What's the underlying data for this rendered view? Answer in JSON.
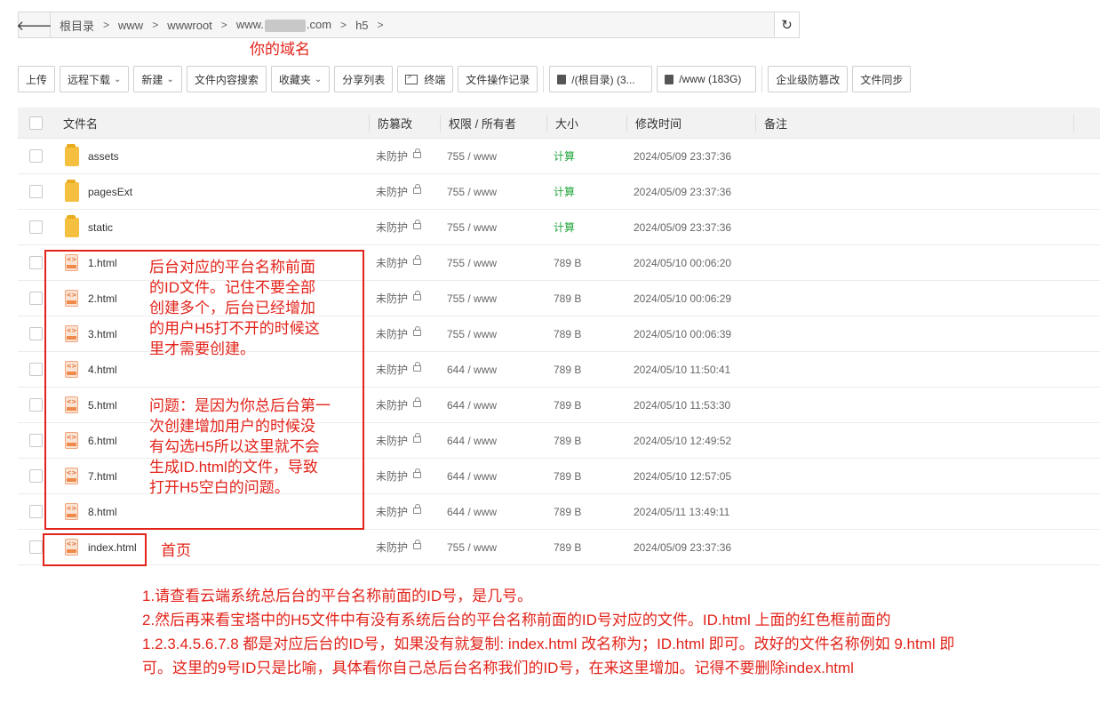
{
  "pathbar": {
    "back_icon": "arrow-left-icon",
    "crumbs": [
      "根目录",
      "www",
      "wwwroot",
      "www.",
      ".com",
      "h5"
    ],
    "refresh_icon": "refresh-icon"
  },
  "domain_note": "你的域名",
  "toolbar": {
    "upload": "上传",
    "remote_download": "远程下载",
    "new": "新建",
    "content_search": "文件内容搜索",
    "favorites": "收藏夹",
    "share_list": "分享列表",
    "terminal": "终端",
    "file_log": "文件操作记录",
    "disk_root": "/(根目录) (3...",
    "disk_www": "/www (183G)",
    "tamper_protect": "企业级防篡改",
    "file_sync": "文件同步"
  },
  "table": {
    "headers": {
      "name": "文件名",
      "tamper": "防篡改",
      "perm": "权限 / 所有者",
      "size": "大小",
      "mtime": "修改时间",
      "remark": "备注"
    },
    "rows": [
      {
        "type": "folder",
        "name": "assets",
        "tamper": "未防护",
        "perm": "755 / www",
        "size": "计算",
        "mtime": "2024/05/09 23:37:36"
      },
      {
        "type": "folder",
        "name": "pagesExt",
        "tamper": "未防护",
        "perm": "755 / www",
        "size": "计算",
        "mtime": "2024/05/09 23:37:36"
      },
      {
        "type": "folder",
        "name": "static",
        "tamper": "未防护",
        "perm": "755 / www",
        "size": "计算",
        "mtime": "2024/05/09 23:37:36"
      },
      {
        "type": "html",
        "name": "1.html",
        "tamper": "未防护",
        "perm": "755 / www",
        "size": "789 B",
        "mtime": "2024/05/10 00:06:20"
      },
      {
        "type": "html",
        "name": "2.html",
        "tamper": "未防护",
        "perm": "755 / www",
        "size": "789 B",
        "mtime": "2024/05/10 00:06:29"
      },
      {
        "type": "html",
        "name": "3.html",
        "tamper": "未防护",
        "perm": "755 / www",
        "size": "789 B",
        "mtime": "2024/05/10 00:06:39"
      },
      {
        "type": "html",
        "name": "4.html",
        "tamper": "未防护",
        "perm": "644 / www",
        "size": "789 B",
        "mtime": "2024/05/10 11:50:41"
      },
      {
        "type": "html",
        "name": "5.html",
        "tamper": "未防护",
        "perm": "644 / www",
        "size": "789 B",
        "mtime": "2024/05/10 11:53:30"
      },
      {
        "type": "html",
        "name": "6.html",
        "tamper": "未防护",
        "perm": "644 / www",
        "size": "789 B",
        "mtime": "2024/05/10 12:49:52"
      },
      {
        "type": "html",
        "name": "7.html",
        "tamper": "未防护",
        "perm": "644 / www",
        "size": "789 B",
        "mtime": "2024/05/10 12:57:05"
      },
      {
        "type": "html",
        "name": "8.html",
        "tamper": "未防护",
        "perm": "644 / www",
        "size": "789 B",
        "mtime": "2024/05/11 13:49:11"
      },
      {
        "type": "html",
        "name": "index.html",
        "tamper": "未防护",
        "perm": "755 / www",
        "size": "789 B",
        "mtime": "2024/05/09 23:37:36"
      }
    ]
  },
  "annotations": {
    "id_files_note": [
      "后台对应的平台名称前面",
      "的ID文件。记住不要全部",
      "创建多个，后台已经增加",
      "的用户H5打不开的时候这",
      "里才需要创建。"
    ],
    "problem_note": [
      "问题：是因为你总后台第一",
      "次创建增加用户的时候没",
      "有勾选H5所以这里就不会",
      "生成ID.html的文件，导致",
      "打开H5空白的问题。"
    ],
    "index_note": "首页",
    "bottom_note": [
      "1.请查看云端系统总后台的平台名称前面的ID号，是几号。",
      "2.然后再来看宝塔中的H5文件中有没有系统后台的平台名称前面的ID号对应的文件。ID.html    上面的红色框前面的",
      "1.2.3.4.5.6.7.8 都是对应后台的ID号，如果没有就复制: index.html  改名称为；ID.html 即可。改好的文件名称例如 9.html 即",
      "可。这里的9号ID只是比喻，具体看你自己总后台名称我们的ID号，在来这里增加。记得不要删除index.html"
    ]
  },
  "colors": {
    "annotation_red": "#e2231a",
    "calc_green": "#20a53a",
    "folder_yellow": "#f5c040"
  }
}
